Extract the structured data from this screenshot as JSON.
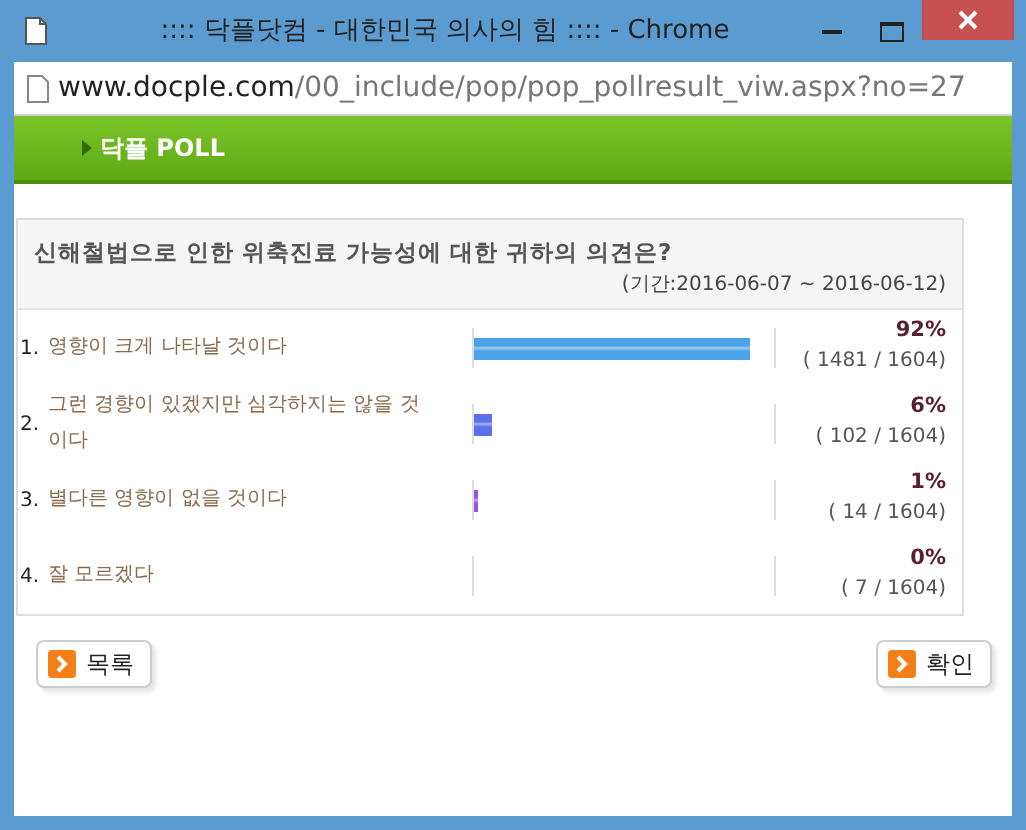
{
  "window": {
    "title": ":::: 닥플닷컴 - 대한민국 의사의 힘 :::: - Chrome"
  },
  "address_bar": {
    "domain": "www.docple.com",
    "path": "/00_include/pop/pop_pollresult_viw.aspx?no=27"
  },
  "header": {
    "title": "닥플 POLL"
  },
  "poll": {
    "question": "신해철법으로 인한 위축진료 가능성에 대한 귀하의 의견은?",
    "period": "(기간:2016-06-07 ~ 2016-06-12)",
    "options": [
      {
        "number": "1.",
        "text": "영향이 크게 나타날 것이다",
        "percent": "92%",
        "count": "( 1481 / 1604)",
        "level": 0.92,
        "color": "#4aa3e8"
      },
      {
        "number": "2.",
        "text": "그런 경향이 있겠지만 심각하지는 않을 것이다",
        "percent": "6%",
        "count": "( 102 / 1604)",
        "level": 0.06,
        "color": "#5a70e6"
      },
      {
        "number": "3.",
        "text": "별다른 영향이 없을 것이다",
        "percent": "1%",
        "count": "( 14 / 1604)",
        "level": 0.01,
        "color": "#9b55e2"
      },
      {
        "number": "4.",
        "text": "잘 모르겠다",
        "percent": "0%",
        "count": "( 7 / 1604)"
      }
    ]
  },
  "buttons": [
    {
      "label": "목록"
    },
    {
      "label": "확인"
    }
  ]
}
